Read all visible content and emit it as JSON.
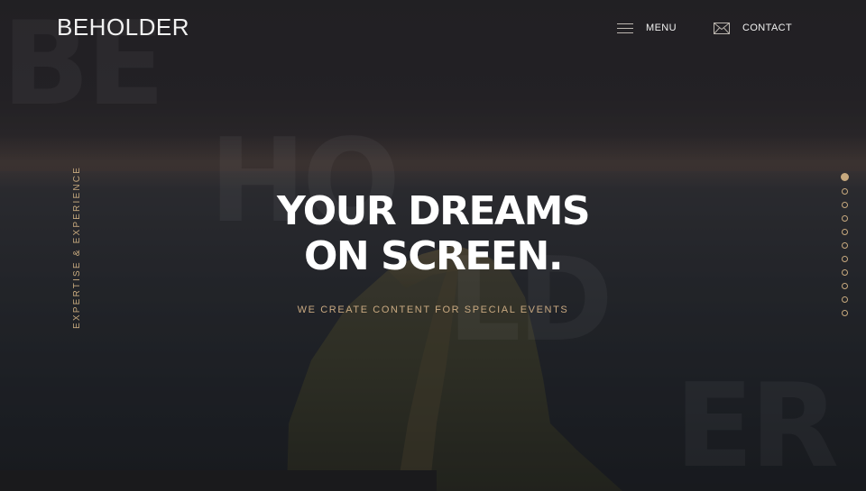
{
  "brand": {
    "logo_text": "BEHOLDER"
  },
  "background_letters": {
    "be": "BE",
    "ho": "HO",
    "ld": "LD",
    "er": "ER"
  },
  "nav": {
    "menu_label": "MENU",
    "menu_icon": "hamburger-icon",
    "contact_label": "CONTACT",
    "contact_icon": "envelope-icon"
  },
  "side": {
    "vertical_text": "EXPERTISE & EXPERIENCE"
  },
  "hero": {
    "title_line1": "YOUR DREAMS",
    "title_line2": "ON SCREEN.",
    "subtitle": "WE CREATE CONTENT FOR SPECIAL EVENTS"
  },
  "slider": {
    "total_slides": 11,
    "active_index": 0
  },
  "colors": {
    "accent": "#c7a97e",
    "text": "#ffffff",
    "background": "#1b1a1c"
  }
}
